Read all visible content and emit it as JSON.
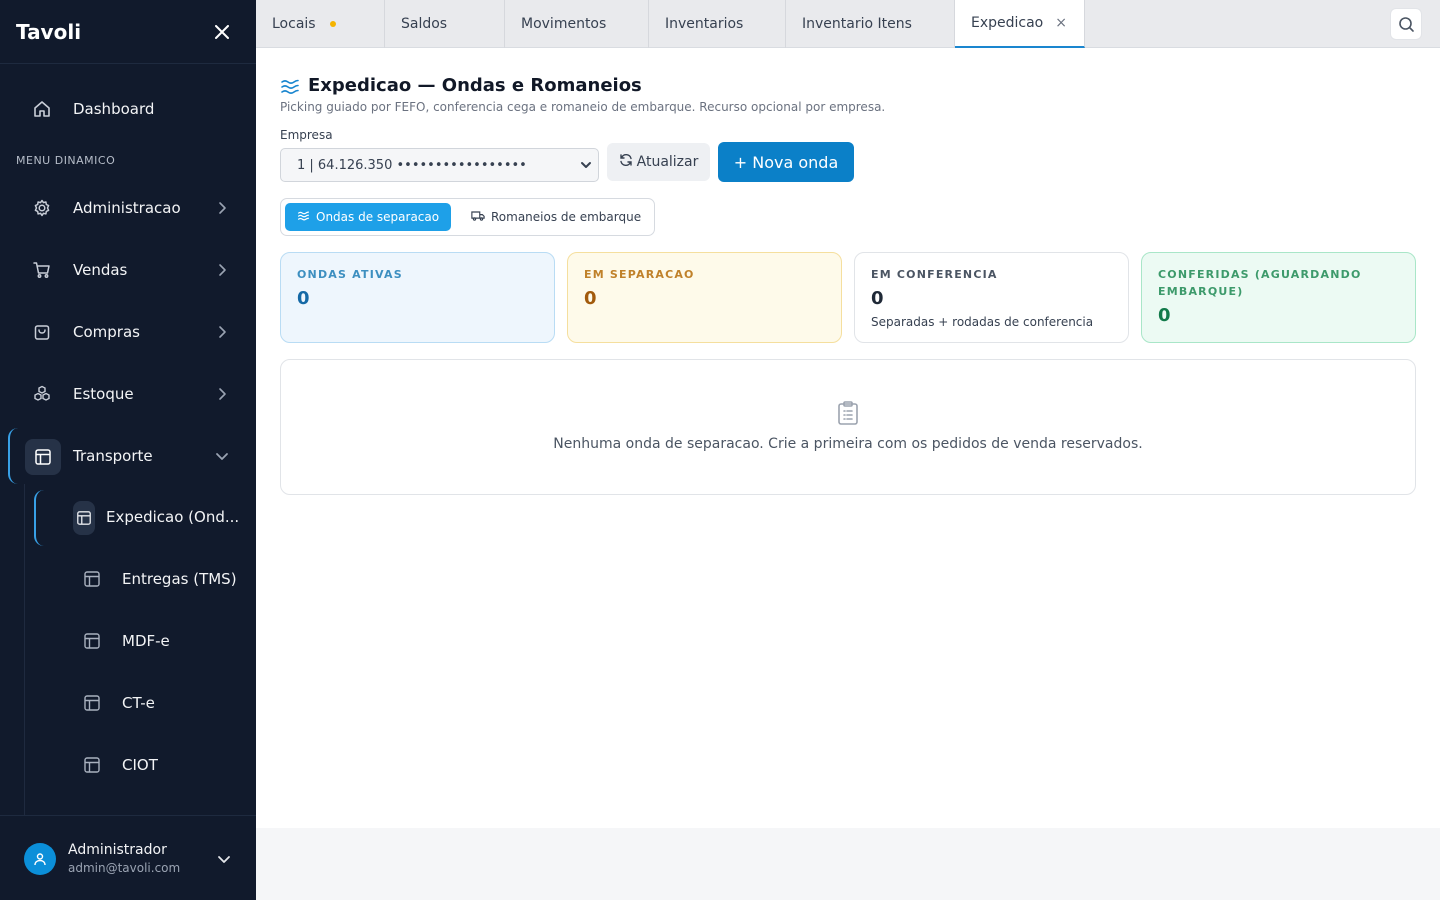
{
  "app": {
    "brand": "Tavoli"
  },
  "sidebar": {
    "section_label": "MENU DINAMICO",
    "items": [
      {
        "label": "Dashboard",
        "icon": "home-icon"
      },
      {
        "label": "Administracao",
        "icon": "gear-icon"
      },
      {
        "label": "Vendas",
        "icon": "cart-icon"
      },
      {
        "label": "Compras",
        "icon": "bag-icon"
      },
      {
        "label": "Estoque",
        "icon": "boxes-icon"
      },
      {
        "label": "Transporte",
        "icon": "layout-icon",
        "expanded": true
      }
    ],
    "sub_items": [
      {
        "label": "Expedicao (Ond...",
        "active": true
      },
      {
        "label": "Entregas (TMS)"
      },
      {
        "label": "MDF-e"
      },
      {
        "label": "CT-e"
      },
      {
        "label": "CIOT"
      }
    ],
    "user": {
      "name": "Administrador",
      "email": "admin@tavoli.com"
    }
  },
  "tabs": [
    {
      "label": "Locais",
      "modified": true
    },
    {
      "label": "Saldos"
    },
    {
      "label": "Movimentos"
    },
    {
      "label": "Inventarios"
    },
    {
      "label": "Inventario Itens"
    },
    {
      "label": "Expedicao",
      "active": true,
      "close": "×"
    }
  ],
  "page": {
    "title": "Expedicao — Ondas e Romaneios",
    "subtitle": "Picking guiado por FEFO, conferencia cega e romaneio de embarque. Recurso opcional por empresa.",
    "empresa_label": "Empresa",
    "empresa_value": "1 | 64.126.350 •••••••••••••••••",
    "refresh_label": "Atualizar",
    "new_wave_label": "+ Nova onda",
    "segments": {
      "waves": "Ondas de separacao",
      "manifests": "Romaneios de embarque"
    },
    "cards": [
      {
        "title": "ONDAS ATIVAS",
        "value": "0"
      },
      {
        "title": "EM SEPARACAO",
        "value": "0"
      },
      {
        "title": "EM CONFERENCIA",
        "value": "0",
        "sub": "Separadas + rodadas de conferencia"
      },
      {
        "title": "CONFERIDAS (AGUARDANDO EMBARQUE)",
        "value": "0"
      }
    ],
    "empty_text": "Nenhuma onda de separacao. Crie a primeira com os pedidos de venda reservados."
  },
  "colors": {
    "sidebar_bg": "#111a2c",
    "accent": "#0b80c8",
    "active_tab_border": "#1a86cf",
    "modified_dot": "#f5b400"
  }
}
